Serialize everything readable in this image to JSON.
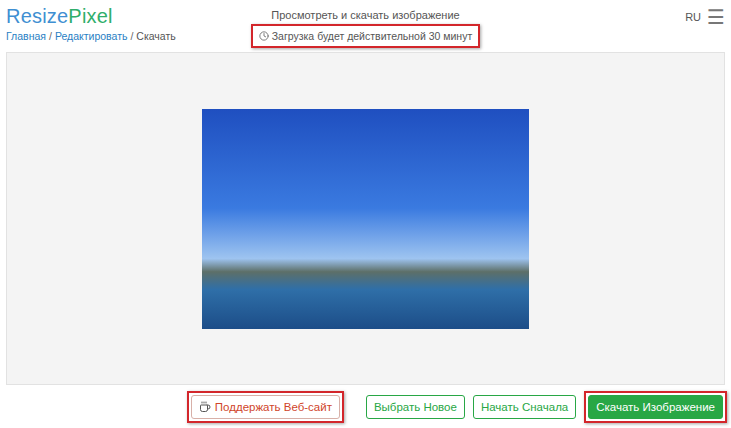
{
  "header": {
    "logo": [
      {
        "text": "Resize",
        "color": "#3f8fd2"
      },
      {
        "text": "Pixel",
        "color": "#2fae6b"
      }
    ],
    "breadcrumb": {
      "separator": "/",
      "items": [
        {
          "label": "Главная",
          "current": false
        },
        {
          "label": "Редактировать",
          "current": false
        },
        {
          "label": "Скачать",
          "current": true
        }
      ]
    },
    "title": "Просмотреть и скачать изображение",
    "notice": {
      "text": "Загрузка будет действительной 30 минут",
      "highlighted": true
    },
    "language": "RU",
    "menu": "☰"
  },
  "preview": {
    "image": "photo"
  },
  "buttons": [
    {
      "label": "Поддержать Веб-сайт",
      "kind": "support",
      "highlighted": true
    },
    {
      "label": "Выбрать Новое",
      "kind": "outline",
      "highlighted": false
    },
    {
      "label": "Начать Сначала",
      "kind": "outline",
      "highlighted": false
    },
    {
      "label": "Скачать Изображение",
      "kind": "primary",
      "highlighted": true
    }
  ]
}
